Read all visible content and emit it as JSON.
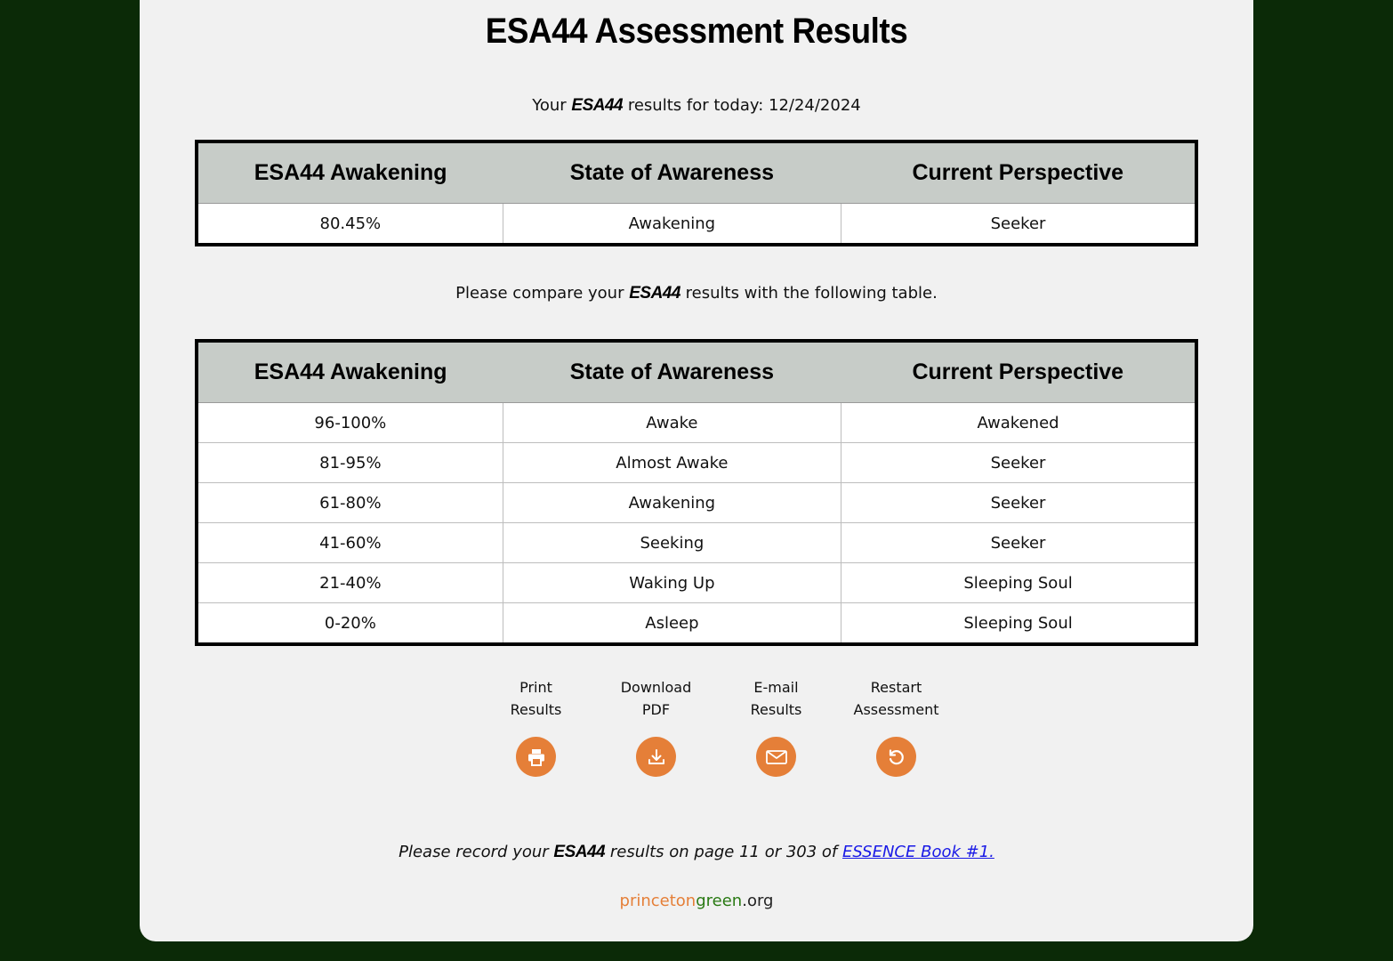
{
  "page": {
    "title": "ESA44 Assessment Results",
    "brand": "ESA44"
  },
  "intro": {
    "prefix": "Your",
    "suffix": "results for today: 12/24/2024"
  },
  "results_table": {
    "headers": [
      "ESA44 Awakening",
      "State of Awareness",
      "Current Perspective"
    ],
    "row": [
      "80.45%",
      "Awakening",
      "Seeker"
    ]
  },
  "compare": {
    "prefix": "Please compare your",
    "suffix": "results with the following table."
  },
  "reference_table": {
    "headers": [
      "ESA44 Awakening",
      "State of Awareness",
      "Current Perspective"
    ],
    "rows": [
      [
        "96-100%",
        "Awake",
        "Awakened"
      ],
      [
        "81-95%",
        "Almost Awake",
        "Seeker"
      ],
      [
        "61-80%",
        "Awakening",
        "Seeker"
      ],
      [
        "41-60%",
        "Seeking",
        "Seeker"
      ],
      [
        "21-40%",
        "Waking Up",
        "Sleeping Soul"
      ],
      [
        "0-20%",
        "Asleep",
        "Sleeping Soul"
      ]
    ]
  },
  "actions": [
    {
      "line1": "Print",
      "line2": "Results",
      "icon": "printer-icon"
    },
    {
      "line1": "Download",
      "line2": "PDF",
      "icon": "download-icon"
    },
    {
      "line1": "E-mail",
      "line2": "Results",
      "icon": "envelope-icon"
    },
    {
      "line1": "Restart",
      "line2": "Assessment",
      "icon": "restart-icon"
    }
  ],
  "footnote": {
    "prefix": "Please record your",
    "middle": "results on page 11 or 303 of",
    "link": "ESSENCE Book #1."
  },
  "site": {
    "part1": "princeton",
    "part2": "green",
    "part3": ".org"
  },
  "colors": {
    "background": "#0b2a07",
    "card": "#f1f1f1",
    "table_header": "#c7ccc8",
    "accent_orange": "#e57f38",
    "site_green": "#2a7a14",
    "link": "#1a1ae6"
  }
}
